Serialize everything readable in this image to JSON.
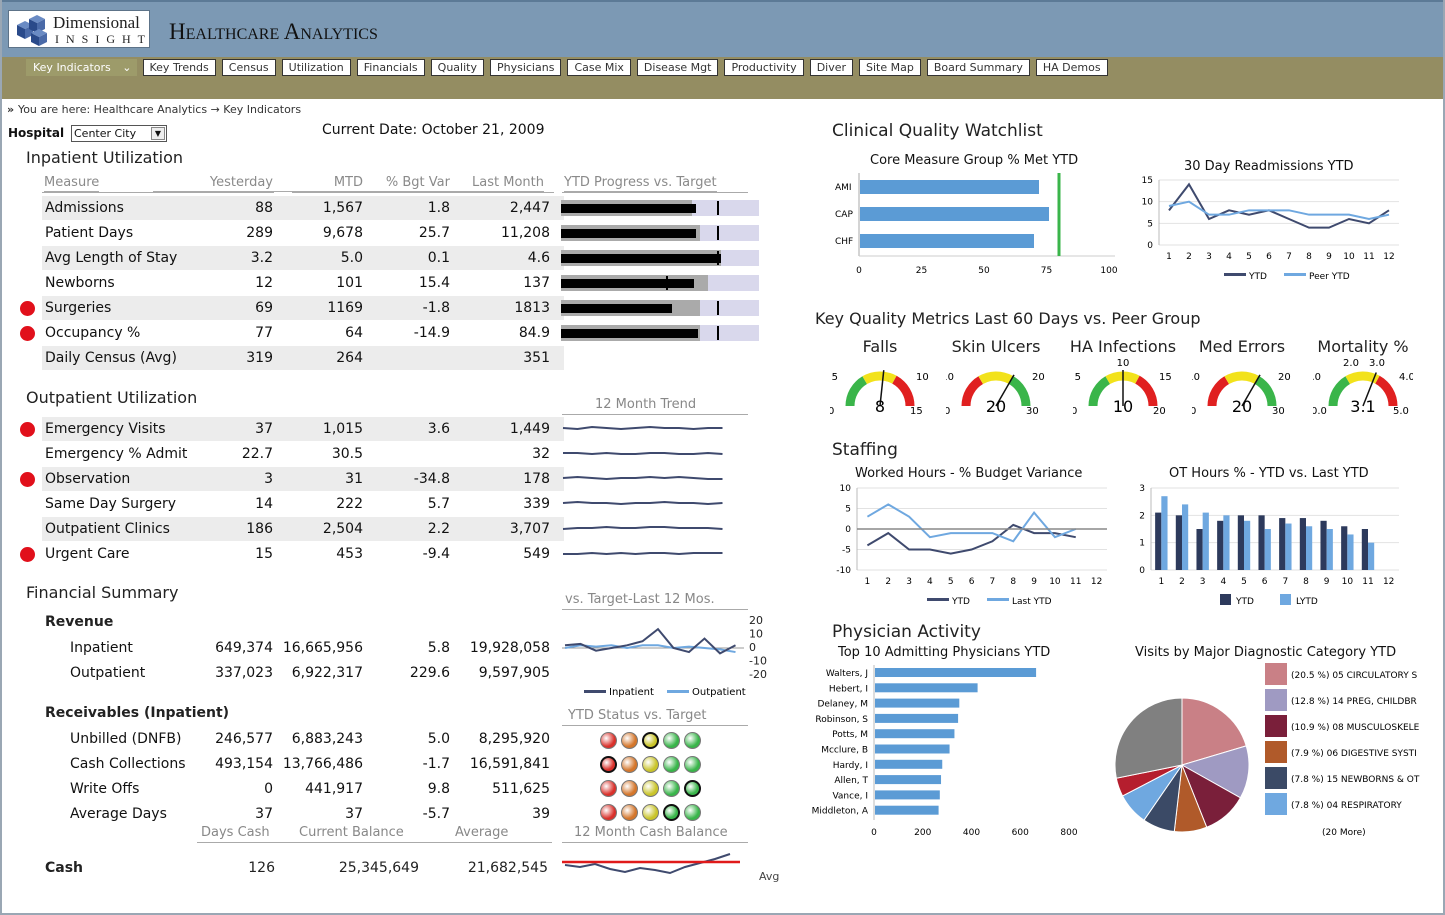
{
  "app": {
    "logo_name": "Dimensional",
    "logo_sub": "INSIGHT",
    "title": "Healthcare Analytics"
  },
  "nav": [
    "Key Indicators",
    "Key Trends",
    "Census",
    "Utilization",
    "Financials",
    "Quality",
    "Physicians",
    "Case Mix",
    "Disease Mgt",
    "Productivity",
    "Diver",
    "Site Map",
    "Board Summary",
    "HA Demos"
  ],
  "breadcrumb": "You are here:  Healthcare Analytics → Key Indicators",
  "hospital_label": "Hospital",
  "hospital_value": "Center City",
  "current_date": "Current Date: October 21, 2009",
  "inpatient": {
    "title": "Inpatient Utilization",
    "headers": [
      "Measure",
      "Yesterday",
      "MTD",
      "% Bgt Var",
      "Last Month",
      "YTD Progress vs. Target"
    ],
    "rows": [
      {
        "label": "Admissions",
        "yesterday": "88",
        "mtd": "1,567",
        "var": "1.8",
        "last": "2,447",
        "alert": false,
        "progress": 0.66,
        "bar": 0.68,
        "target": 0.79
      },
      {
        "label": "Patient Days",
        "yesterday": "289",
        "mtd": "9,678",
        "var": "25.7",
        "last": "11,208",
        "alert": false,
        "progress": 0.7,
        "bar": 0.68,
        "target": 0.79
      },
      {
        "label": "Avg Length of Stay",
        "yesterday": "3.2",
        "mtd": "5.0",
        "var": "0.1",
        "last": "4.6",
        "alert": false,
        "progress": 0.81,
        "bar": 0.81,
        "target": 0.79
      },
      {
        "label": "Newborns",
        "yesterday": "12",
        "mtd": "101",
        "var": "15.4",
        "last": "137",
        "alert": false,
        "progress": 0.74,
        "bar": 0.67,
        "target": 0.53
      },
      {
        "label": "Surgeries",
        "yesterday": "69",
        "mtd": "1169",
        "var": "-1.8",
        "last": "1813",
        "alert": true,
        "progress": 0.7,
        "bar": 0.56,
        "target": 0.79
      },
      {
        "label": "Occupancy %",
        "yesterday": "77",
        "mtd": "64",
        "var": "-14.9",
        "last": "84.9",
        "alert": true,
        "progress": 0.7,
        "bar": 0.69,
        "target": 0.79
      },
      {
        "label": "Daily Census (Avg)",
        "yesterday": "319",
        "mtd": "264",
        "var": "",
        "last": "351",
        "alert": false,
        "progress": null,
        "bar": null,
        "target": null
      }
    ]
  },
  "outpatient": {
    "title": "Outpatient Utilization",
    "trend_label": "12 Month Trend",
    "rows": [
      {
        "label": "Emergency Visits",
        "yesterday": "37",
        "mtd": "1,015",
        "var": "3.6",
        "last": "1,449",
        "alert": true
      },
      {
        "label": "Emergency % Admit",
        "yesterday": "22.7",
        "mtd": "30.5",
        "var": "",
        "last": "32",
        "alert": false
      },
      {
        "label": "Observation",
        "yesterday": "3",
        "mtd": "31",
        "var": "-34.8",
        "last": "178",
        "alert": true
      },
      {
        "label": "Same Day Surgery",
        "yesterday": "14",
        "mtd": "222",
        "var": "5.7",
        "last": "339",
        "alert": false
      },
      {
        "label": "Outpatient Clinics",
        "yesterday": "186",
        "mtd": "2,504",
        "var": "2.2",
        "last": "3,707",
        "alert": false
      },
      {
        "label": "Urgent Care",
        "yesterday": "15",
        "mtd": "453",
        "var": "-9.4",
        "last": "549",
        "alert": true
      }
    ]
  },
  "financial": {
    "title": "Financial Summary",
    "vs_target_label": "vs. Target-Last 12 Mos.",
    "revenue_label": "Revenue",
    "revenue_rows": [
      {
        "label": "Inpatient",
        "c1": "649,374",
        "c2": "16,665,956",
        "var": "5.8",
        "last": "19,928,058"
      },
      {
        "label": "Outpatient",
        "c1": "337,023",
        "c2": "6,922,317",
        "var": "229.6",
        "last": "9,597,905"
      }
    ],
    "legend": [
      "Inpatient",
      "Outpatient"
    ],
    "y_ticks": [
      "20",
      "10",
      "0",
      "-10",
      "-20"
    ],
    "receivables_label": "Receivables (Inpatient)",
    "ytd_status_label": "YTD Status vs. Target",
    "receivable_rows": [
      {
        "label": "Unbilled (DNFB)",
        "c1": "246,577",
        "c2": "6,883,243",
        "var": "5.0",
        "last": "8,295,920"
      },
      {
        "label": "Cash Collections",
        "c1": "493,154",
        "c2": "13,766,486",
        "var": "-1.7",
        "last": "16,591,841"
      },
      {
        "label": "Write Offs",
        "c1": "0",
        "c2": "441,917",
        "var": "9.8",
        "last": "511,625"
      },
      {
        "label": "Average Days",
        "c1": "37",
        "c2": "37",
        "var": "-5.7",
        "last": "39"
      }
    ],
    "status_lights": [
      [
        0,
        1,
        2,
        3,
        3
      ],
      [
        0,
        1,
        2,
        3,
        3
      ],
      [
        0,
        1,
        2,
        3,
        3
      ],
      [
        0,
        1,
        2,
        3,
        3
      ]
    ],
    "status_selected": [
      2,
      0,
      4,
      3
    ],
    "sub_headers": [
      "Days Cash",
      "Current Balance",
      "Average",
      "12 Month Cash Balance"
    ],
    "cash": {
      "label": "Cash",
      "c1": "126",
      "c2": "25,345,649",
      "last": "21,682,545",
      "avg_label": "Avg"
    }
  },
  "clinical": {
    "title": "Clinical Quality Watchlist"
  },
  "core_measure": {
    "title": "Core Measure Group % Met YTD",
    "categories": [
      "AMI",
      "CAP",
      "CHF"
    ],
    "values": [
      72,
      76,
      70
    ],
    "target": 80,
    "x_ticks": [
      "0",
      "25",
      "50",
      "75",
      "100"
    ],
    "xlim": [
      0,
      100
    ]
  },
  "readmissions": {
    "title": "30 Day Readmissions YTD",
    "x": [
      "1",
      "2",
      "3",
      "4",
      "5",
      "6",
      "7",
      "8",
      "9",
      "10",
      "11",
      "12"
    ],
    "y_ticks": [
      "15",
      "10",
      "5",
      "0"
    ],
    "ylim": [
      0,
      15
    ],
    "series": [
      {
        "name": "YTD",
        "values": [
          8,
          14,
          6,
          8,
          7,
          8,
          6,
          4,
          4,
          6,
          5,
          8
        ],
        "color": "#3f4a6e"
      },
      {
        "name": "Peer YTD",
        "values": [
          9,
          10,
          7,
          7,
          8,
          8,
          8,
          7,
          7,
          7,
          6,
          7
        ],
        "color": "#6fa8e0"
      }
    ]
  },
  "kqm": {
    "title": "Key Quality Metrics Last 60 Days vs. Peer Group",
    "gauges": [
      {
        "title": "Falls",
        "value": "8",
        "v": 8,
        "min": "0",
        "max": "15",
        "t1": "5",
        "t2": "10",
        "lo": 0,
        "hi": 15
      },
      {
        "title": "Skin Ulcers",
        "value": "20",
        "v": 20,
        "min": "0",
        "max": "30",
        "t1": "10",
        "t2": "20",
        "lo": 0,
        "hi": 30
      },
      {
        "title": "HA Infections",
        "value": "10",
        "v": 10,
        "min": "0",
        "max": "20",
        "t1": "5",
        "t2": "15",
        "t3": "10",
        "lo": 0,
        "hi": 20
      },
      {
        "title": "Med Errors",
        "value": "20",
        "v": 20,
        "min": "0",
        "max": "30",
        "t1": "10",
        "t2": "20",
        "lo": 0,
        "hi": 30
      },
      {
        "title": "Mortality %",
        "value": "3.1",
        "v": 3.1,
        "min": "0.0",
        "max": "5.0",
        "t1": "1.0",
        "t2": "4.0",
        "t3": "2.0",
        "t4": "3.0",
        "lo": 0,
        "hi": 5
      }
    ]
  },
  "staffing": {
    "title": "Staffing"
  },
  "worked_hours": {
    "title": "Worked Hours - % Budget Variance",
    "x": [
      "1",
      "2",
      "3",
      "4",
      "5",
      "6",
      "7",
      "8",
      "9",
      "10",
      "11",
      "12"
    ],
    "y_ticks": [
      "10",
      "5",
      "0",
      "-5",
      "-10"
    ],
    "ylim": [
      -10,
      10
    ],
    "series": [
      {
        "name": "YTD",
        "values": [
          -4,
          -1,
          -5,
          -5,
          -6,
          -5,
          -3,
          1,
          -1,
          -1,
          -2,
          null
        ],
        "color": "#3f4a6e"
      },
      {
        "name": "Last YTD",
        "values": [
          3,
          6,
          3,
          -2,
          -1,
          -1,
          -1,
          -3,
          4,
          -2,
          0,
          null
        ],
        "color": "#6fa8e0"
      }
    ]
  },
  "ot_hours": {
    "title": "OT Hours % - YTD vs. Last YTD",
    "x": [
      "1",
      "2",
      "3",
      "4",
      "5",
      "6",
      "7",
      "8",
      "9",
      "10",
      "11",
      "12"
    ],
    "y_ticks": [
      "3",
      "2",
      "1",
      "0"
    ],
    "ylim": [
      0,
      3
    ],
    "series": [
      {
        "name": "YTD",
        "values": [
          2.1,
          2.0,
          1.5,
          1.8,
          2.0,
          2.0,
          1.9,
          1.9,
          1.8,
          1.6,
          1.5,
          null
        ],
        "color": "#2d3a5c"
      },
      {
        "name": "LYTD",
        "values": [
          2.7,
          2.4,
          2.1,
          2.0,
          1.8,
          1.5,
          1.7,
          1.6,
          1.5,
          1.3,
          1.0,
          null
        ],
        "color": "#6fa8e0"
      }
    ]
  },
  "physician": {
    "title": "Physician Activity",
    "top10_title": "Top 10 Admitting Physicians YTD",
    "names": [
      "Walters, J",
      "Hebert, I",
      "Delaney, M",
      "Robinson, S",
      "Potts, M",
      "Mcclure, B",
      "Hardy, I",
      "Allen, T",
      "Vance, I",
      "Middleton, A"
    ],
    "values": [
      665,
      425,
      350,
      345,
      330,
      310,
      280,
      275,
      270,
      265
    ],
    "x_ticks": [
      "0",
      "200",
      "400",
      "600",
      "800"
    ],
    "xlim": [
      0,
      800
    ]
  },
  "pie": {
    "title": "Visits by Major Diagnostic Category YTD",
    "slices": [
      {
        "label": "(20.5 %) 05 CIRCULATORY S",
        "value": 20.5,
        "color": "#c98086"
      },
      {
        "label": "(12.8 %) 14 PREG, CHILDBR",
        "value": 12.8,
        "color": "#9f9ac2"
      },
      {
        "label": "(10.9 %) 08 MUSCULOSKELE",
        "value": 10.9,
        "color": "#7a1f3a"
      },
      {
        "label": "(7.9 %) 06 DIGESTIVE SYSTI",
        "value": 7.9,
        "color": "#b05a2a"
      },
      {
        "label": "(7.8 %) 15 NEWBORNS & OT",
        "value": 7.8,
        "color": "#3b4a66"
      },
      {
        "label": "(7.8 %) 04 RESPIRATORY",
        "value": 7.8,
        "color": "#6fa8e0"
      },
      {
        "label": "",
        "value": 4.5,
        "color": "#b51e2e"
      },
      {
        "label": "",
        "value": 28.3,
        "color": "#808080"
      }
    ],
    "more": "(20 More)"
  }
}
